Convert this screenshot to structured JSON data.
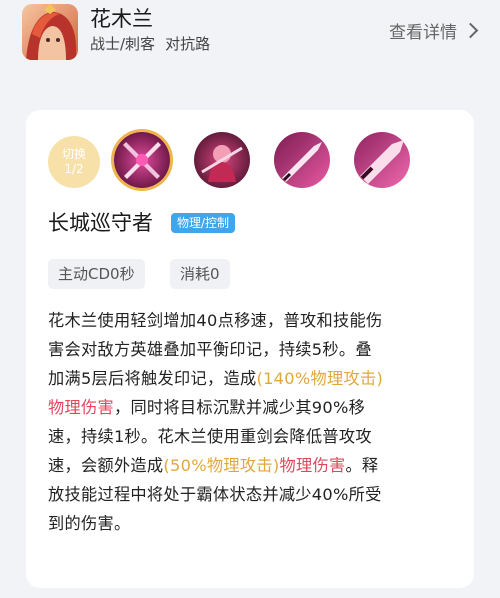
{
  "hero": {
    "name": "花木兰",
    "roles": "战士/刺客",
    "lane": "对抗路",
    "detail_link": "查看详情"
  },
  "skills_panel": {
    "switch_label": "切换",
    "switch_count": "1/2",
    "skill_icons": [
      "skill-icon-1-crossed-blades",
      "skill-icon-2-warrior",
      "skill-icon-3-blade",
      "skill-icon-4-blade"
    ],
    "selected_index": 0
  },
  "skill": {
    "name": "长城巡守者",
    "tag": "物理/控制",
    "cooldown": "主动CD0秒",
    "cost": "消耗0",
    "description_lines": [
      [
        {
          "t": "花木兰使用轻剑增加40点移速，普攻和技能伤"
        }
      ],
      [
        {
          "t": "害会对敌方英雄叠加平衡印记，持续5秒。叠"
        }
      ],
      [
        {
          "t": "加满5层后将触发印记，造成"
        },
        {
          "t": "(140%物理攻击)",
          "c": "gold"
        }
      ],
      [
        {
          "t": "物理伤害",
          "c": "red"
        },
        {
          "t": "，同时将目标沉默并减少其90%移"
        }
      ],
      [
        {
          "t": "速，持续1秒。花木兰使用重剑会降低普攻攻"
        }
      ],
      [
        {
          "t": "速，会额外造成"
        },
        {
          "t": "(50%物理攻击)",
          "c": "gold"
        },
        {
          "t": "物理伤害",
          "c": "red"
        },
        {
          "t": "。释"
        }
      ],
      [
        {
          "t": "放技能过程中将处于霸体状态并减少40%所受"
        }
      ],
      [
        {
          "t": "到的伤害。"
        }
      ]
    ]
  },
  "colors": {
    "gold": "#e0a83c",
    "red": "#e0475b",
    "tag_blue": "#3fa6ee",
    "switch_bg": "#f7e1a9",
    "selected_ring": "#f0b44c"
  }
}
